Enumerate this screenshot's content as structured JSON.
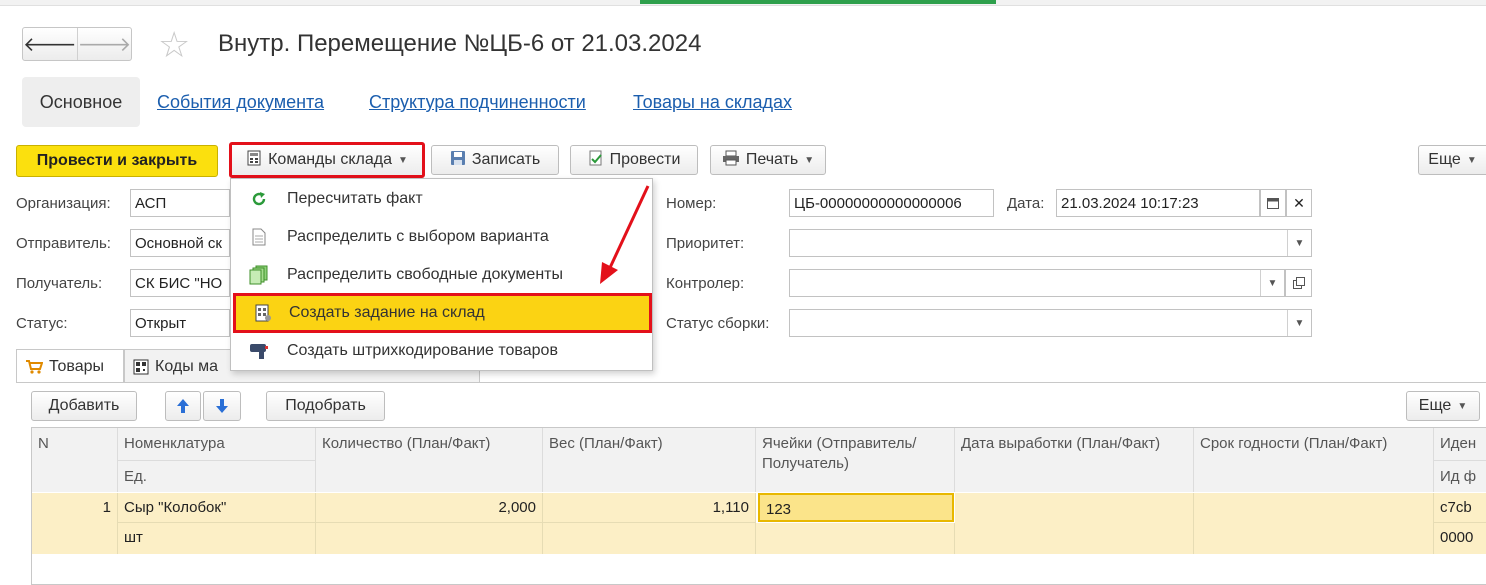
{
  "window": {
    "title": "Внутр. Перемещение №ЦБ-6 от 21.03.2024"
  },
  "nav": {
    "back": "🡐",
    "forward": "🡒",
    "star": "☆"
  },
  "tabs": [
    {
      "label": "Основное"
    },
    {
      "label": "События документа"
    },
    {
      "label": "Структура подчиненности"
    },
    {
      "label": "Товары на складах"
    }
  ],
  "toolbar": {
    "post_close": "Провести и закрыть",
    "warehouse_commands": "Команды склада",
    "save": "Записать",
    "post": "Провести",
    "print": "Печать",
    "more": "Еще"
  },
  "menu": {
    "items": [
      {
        "label": "Пересчитать факт",
        "icon": "refresh-icon"
      },
      {
        "label": "Распределить с выбором варианта",
        "icon": "document-icon"
      },
      {
        "label": "Распределить свободные документы",
        "icon": "documents-icon"
      },
      {
        "label": "Создать задание на склад",
        "icon": "task-icon",
        "selected": true
      },
      {
        "label": "Создать штрихкодирование товаров",
        "icon": "barcode-scanner-icon"
      }
    ]
  },
  "form": {
    "org_label": "Организация:",
    "org_value": "АСП",
    "sender_label": "Отправитель:",
    "sender_value": "Основной ск",
    "receiver_label": "Получатель:",
    "receiver_value": "СК БИС \"НО",
    "status_label": "Статус:",
    "status_value": "Открыт",
    "number_label": "Номер:",
    "number_value": "ЦБ-00000000000000006",
    "date_label": "Дата:",
    "date_value": "21.03.2024 10:17:23",
    "priority_label": "Приоритет:",
    "priority_value": "",
    "controller_label": "Контролер:",
    "controller_value": "",
    "assembly_label": "Статус сборки:",
    "assembly_value": ""
  },
  "lower_tabs": [
    {
      "label": "Товары"
    },
    {
      "label": "Коды ма"
    }
  ],
  "table_toolbar": {
    "add": "Добавить",
    "pick": "Подобрать",
    "more": "Еще"
  },
  "table": {
    "headers": {
      "n": "N",
      "nom": "Номенклатура",
      "unit": "Ед.",
      "qty": "Количество (План/Факт)",
      "weight": "Вес (План/Факт)",
      "cells": "Ячейки (Отправитель/ Получатель)",
      "prod_date": "Дата выработки (План/Факт)",
      "shelf": "Срок годности (План/Факт)",
      "ident": "Иден",
      "ident2": "Ид ф"
    },
    "rows": [
      {
        "n": "1",
        "nom": "Сыр \"Колобок\"",
        "unit": "шт",
        "qty": "2,000",
        "weight": "1,110",
        "cells": "123",
        "ident": "c7cb",
        "ident2": "0000"
      }
    ]
  },
  "colors": {
    "accent_yellow": "#fbe00e",
    "highlight_red": "#e3101a",
    "link_blue": "#1b5eae",
    "row_yellow": "#fcefc6"
  }
}
